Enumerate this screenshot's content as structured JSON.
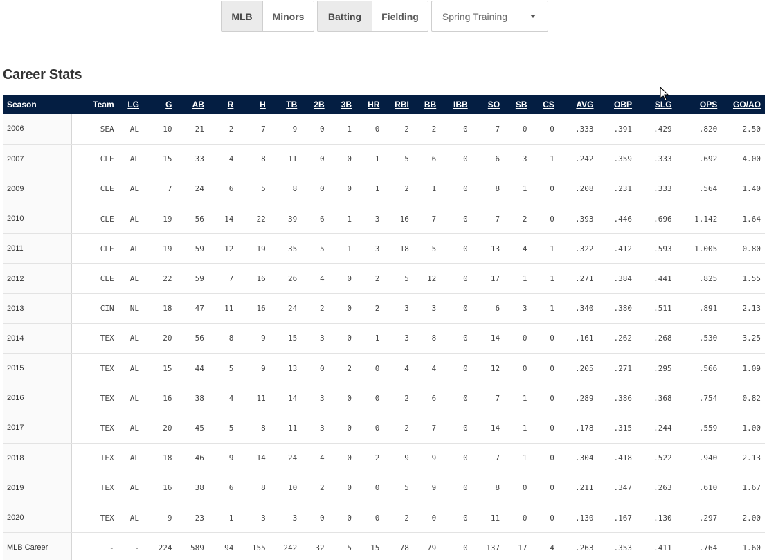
{
  "toolbar": {
    "level_group": [
      {
        "label": "MLB",
        "active": true
      },
      {
        "label": "Minors",
        "active": false
      }
    ],
    "type_group": [
      {
        "label": "Batting",
        "active": true
      },
      {
        "label": "Fielding",
        "active": false
      }
    ],
    "dropdown": {
      "selected": "Spring Training",
      "icon": "chevron-down-icon"
    }
  },
  "section_title": "Career Stats",
  "table": {
    "columns": [
      "Season",
      "Team",
      "LG",
      "G",
      "AB",
      "R",
      "H",
      "TB",
      "2B",
      "3B",
      "HR",
      "RBI",
      "BB",
      "IBB",
      "SO",
      "SB",
      "CS",
      "AVG",
      "OBP",
      "SLG",
      "OPS",
      "GO/AO"
    ],
    "underlined": [
      "LG",
      "G",
      "AB",
      "R",
      "H",
      "TB",
      "2B",
      "3B",
      "HR",
      "RBI",
      "BB",
      "IBB",
      "SO",
      "SB",
      "CS",
      "AVG",
      "OBP",
      "SLG",
      "OPS",
      "GO/AO"
    ],
    "rows": [
      [
        "2006",
        "SEA",
        "AL",
        "10",
        "21",
        "2",
        "7",
        "9",
        "0",
        "1",
        "0",
        "2",
        "2",
        "0",
        "7",
        "0",
        "0",
        ".333",
        ".391",
        ".429",
        ".820",
        "2.50"
      ],
      [
        "2007",
        "CLE",
        "AL",
        "15",
        "33",
        "4",
        "8",
        "11",
        "0",
        "0",
        "1",
        "5",
        "6",
        "0",
        "6",
        "3",
        "1",
        ".242",
        ".359",
        ".333",
        ".692",
        "4.00"
      ],
      [
        "2009",
        "CLE",
        "AL",
        "7",
        "24",
        "6",
        "5",
        "8",
        "0",
        "0",
        "1",
        "2",
        "1",
        "0",
        "8",
        "1",
        "0",
        ".208",
        ".231",
        ".333",
        ".564",
        "1.40"
      ],
      [
        "2010",
        "CLE",
        "AL",
        "19",
        "56",
        "14",
        "22",
        "39",
        "6",
        "1",
        "3",
        "16",
        "7",
        "0",
        "7",
        "2",
        "0",
        ".393",
        ".446",
        ".696",
        "1.142",
        "1.64"
      ],
      [
        "2011",
        "CLE",
        "AL",
        "19",
        "59",
        "12",
        "19",
        "35",
        "5",
        "1",
        "3",
        "18",
        "5",
        "0",
        "13",
        "4",
        "1",
        ".322",
        ".412",
        ".593",
        "1.005",
        "0.80"
      ],
      [
        "2012",
        "CLE",
        "AL",
        "22",
        "59",
        "7",
        "16",
        "26",
        "4",
        "0",
        "2",
        "5",
        "12",
        "0",
        "17",
        "1",
        "1",
        ".271",
        ".384",
        ".441",
        ".825",
        "1.55"
      ],
      [
        "2013",
        "CIN",
        "NL",
        "18",
        "47",
        "11",
        "16",
        "24",
        "2",
        "0",
        "2",
        "3",
        "3",
        "0",
        "6",
        "3",
        "1",
        ".340",
        ".380",
        ".511",
        ".891",
        "2.13"
      ],
      [
        "2014",
        "TEX",
        "AL",
        "20",
        "56",
        "8",
        "9",
        "15",
        "3",
        "0",
        "1",
        "3",
        "8",
        "0",
        "14",
        "0",
        "0",
        ".161",
        ".262",
        ".268",
        ".530",
        "3.25"
      ],
      [
        "2015",
        "TEX",
        "AL",
        "15",
        "44",
        "5",
        "9",
        "13",
        "0",
        "2",
        "0",
        "4",
        "4",
        "0",
        "12",
        "0",
        "0",
        ".205",
        ".271",
        ".295",
        ".566",
        "1.09"
      ],
      [
        "2016",
        "TEX",
        "AL",
        "16",
        "38",
        "4",
        "11",
        "14",
        "3",
        "0",
        "0",
        "2",
        "6",
        "0",
        "7",
        "1",
        "0",
        ".289",
        ".386",
        ".368",
        ".754",
        "0.82"
      ],
      [
        "2017",
        "TEX",
        "AL",
        "20",
        "45",
        "5",
        "8",
        "11",
        "3",
        "0",
        "0",
        "2",
        "7",
        "0",
        "14",
        "1",
        "0",
        ".178",
        ".315",
        ".244",
        ".559",
        "1.00"
      ],
      [
        "2018",
        "TEX",
        "AL",
        "18",
        "46",
        "9",
        "14",
        "24",
        "4",
        "0",
        "2",
        "9",
        "9",
        "0",
        "7",
        "1",
        "0",
        ".304",
        ".418",
        ".522",
        ".940",
        "2.13"
      ],
      [
        "2019",
        "TEX",
        "AL",
        "16",
        "38",
        "6",
        "8",
        "10",
        "2",
        "0",
        "0",
        "5",
        "9",
        "0",
        "8",
        "0",
        "0",
        ".211",
        ".347",
        ".263",
        ".610",
        "1.67"
      ],
      [
        "2020",
        "TEX",
        "AL",
        "9",
        "23",
        "1",
        "3",
        "3",
        "0",
        "0",
        "0",
        "2",
        "0",
        "0",
        "11",
        "0",
        "0",
        ".130",
        ".167",
        ".130",
        ".297",
        "2.00"
      ]
    ],
    "career_row": [
      "MLB Career",
      "-",
      "-",
      "224",
      "589",
      "94",
      "155",
      "242",
      "32",
      "5",
      "15",
      "78",
      "79",
      "0",
      "137",
      "17",
      "4",
      ".263",
      ".353",
      ".411",
      ".764",
      "1.60"
    ]
  },
  "colors": {
    "header_bg": "#041e42",
    "header_text": "#ffffff",
    "active_segment": "#ebebeb"
  }
}
